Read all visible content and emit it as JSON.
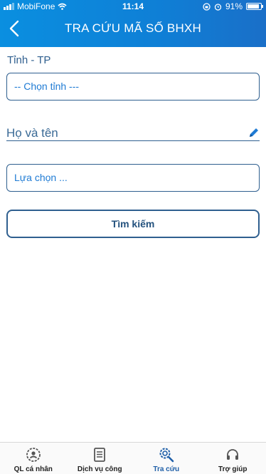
{
  "status_bar": {
    "carrier": "MobiFone",
    "time": "11:14",
    "battery": "91%",
    "battery_level": 0.91
  },
  "header": {
    "title": "TRA CỨU MÃ SỐ BHXH",
    "back_icon": "chevron-left-icon"
  },
  "form": {
    "province_label": "Tỉnh - TP",
    "province_select": "-- Chọn tỉnh ---",
    "name_placeholder": "Họ và tên",
    "edit_icon": "pencil-icon",
    "option_select": "Lựa chọn ...",
    "search_button": "Tìm kiếm"
  },
  "tabs": [
    {
      "label": "QL cá nhân",
      "icon": "user-gear-icon",
      "active": false
    },
    {
      "label": "Dịch vụ công",
      "icon": "document-icon",
      "active": false
    },
    {
      "label": "Tra cứu",
      "icon": "search-gear-icon",
      "active": true
    },
    {
      "label": "Trợ giúp",
      "icon": "headset-icon",
      "active": false
    }
  ],
  "colors": {
    "header": "#0f7fd6",
    "accent": "#1f7bd4",
    "border": "#2f5f8f"
  }
}
